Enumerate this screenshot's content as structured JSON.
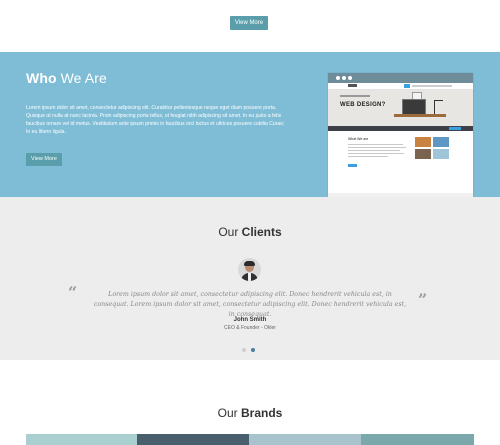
{
  "top": {
    "button_label": "View More"
  },
  "who": {
    "title_bold": "Who",
    "title_rest": " We Are",
    "body": "Lorem ipsum dolor sit amet, consectetur adipiscing elit. Curabitur pellentesque neque eget diam posuere porta. Quisque ut nulla at nunc lacinia. Proin adipiscing porta tellus, ut feugiat nibh adipiscing sit amet. In eu justo a felis faucibus ornare vel id metus. Vestibulum ante ipsum primis in faucibus orci luctus et ultrices posuere cubilia Curae; In eu libero ligula.",
    "button_label": "View More",
    "screenshot": {
      "hero_title": "WEB DESIGN?",
      "section_heading": "What We are"
    }
  },
  "clients": {
    "title_light": "Our ",
    "title_bold": "Clients",
    "open_quote": "“",
    "close_quote": "”",
    "quote": "Lorem ipsum dolor sit amet, consectetur adipiscing elit. Donec hendrerit vehicula est, in consequat. Lorem ipsum dolor sit amet, consectetur adipiscing elit. Donec hendrerit vehicula est, in consequat.",
    "name": "John Smith",
    "role": "CEO & Founder - Okler",
    "carousel_active": 2
  },
  "brands": {
    "title_light": "Our ",
    "title_bold": "Brands",
    "strip_colors": [
      "#a9cfd0",
      "#4a5f6d",
      "#a9c3cc",
      "#7ba8aa"
    ]
  },
  "colors": {
    "accent": "#5b9eab",
    "band": "#7fbdd6",
    "dot_active": "#4a7da0",
    "dot_inactive": "#cfcfcf"
  }
}
